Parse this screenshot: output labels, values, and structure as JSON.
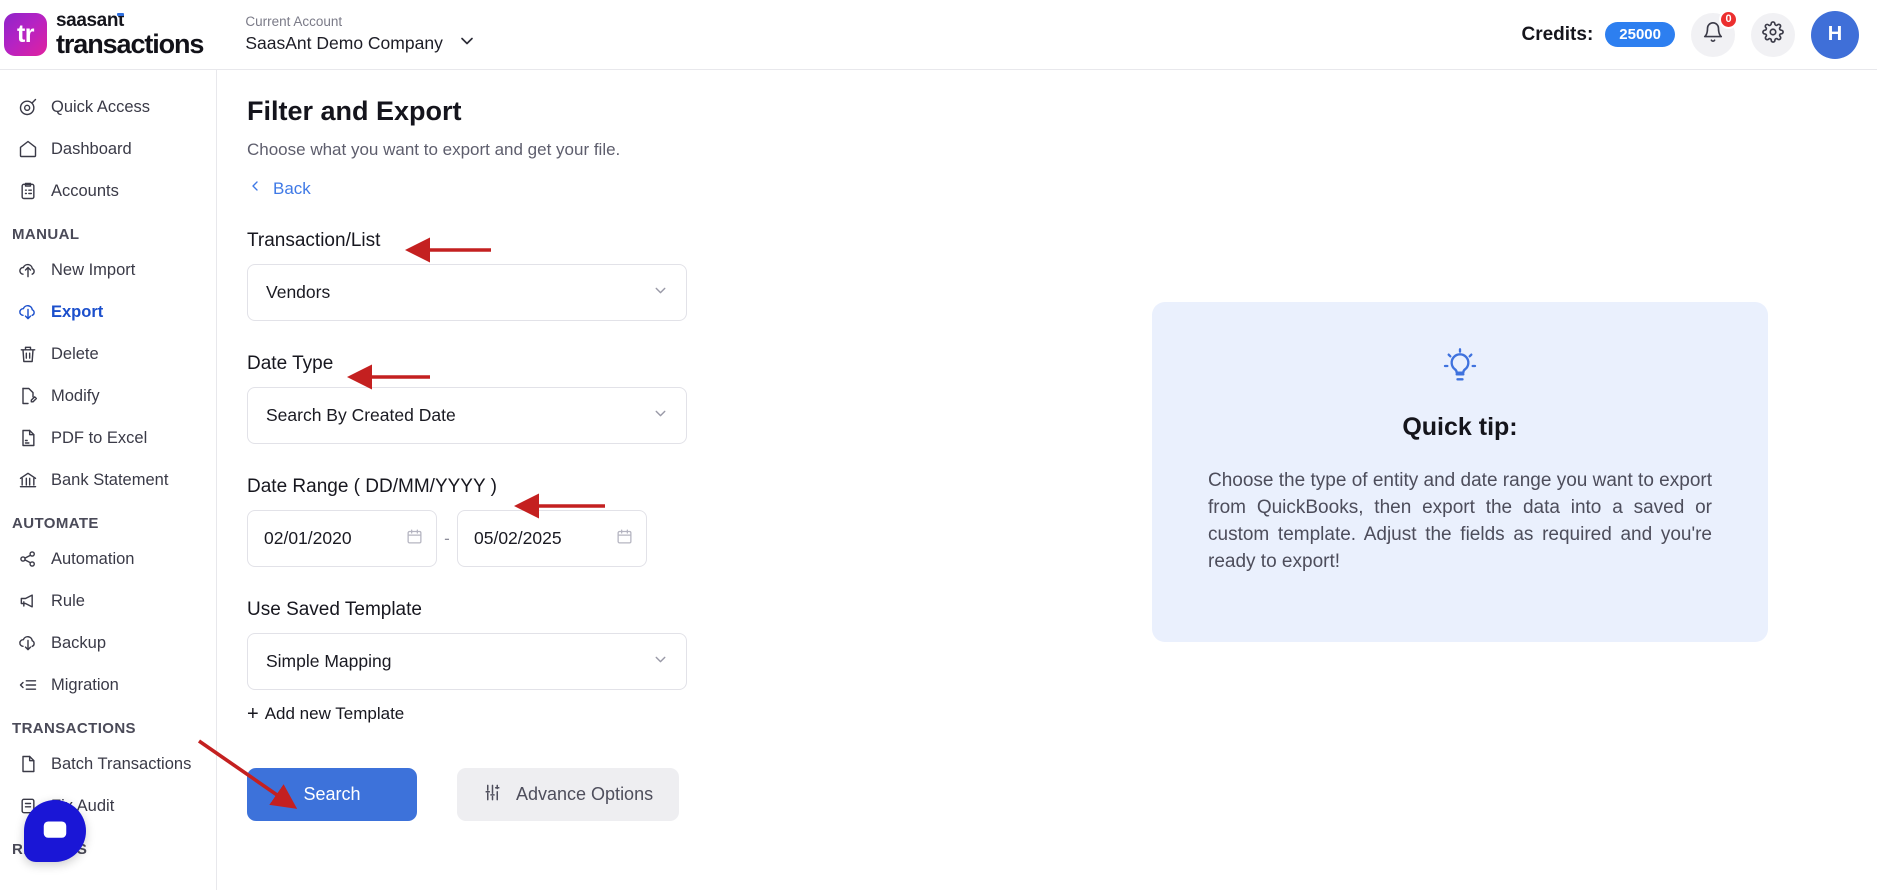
{
  "brand": {
    "logo_mark_text": "tr",
    "name_top": "saasant",
    "name_bottom": "transactions",
    "gradient_from": "#8e24c9",
    "gradient_to": "#e0219f"
  },
  "header": {
    "account_label": "Current Account",
    "account_name": "SaasAnt Demo Company",
    "account_chevron_icon": "chevron-down-icon",
    "credits_label": "Credits:",
    "credits_value": "25000",
    "credits_pill_color": "#2d7ff0",
    "notification_icon": "bell-icon",
    "notification_count": "0",
    "notification_badge_color": "#ec2f2f",
    "settings_icon": "gear-icon",
    "avatar_initial": "H",
    "avatar_color": "#3f6fd8"
  },
  "sidebar": {
    "top_items": [
      {
        "label": "Quick Access",
        "icon": "target-icon",
        "active": false
      },
      {
        "label": "Dashboard",
        "icon": "home-icon",
        "active": false
      },
      {
        "label": "Accounts",
        "icon": "clipboard-icon",
        "active": false
      }
    ],
    "sections": [
      {
        "title": "MANUAL",
        "items": [
          {
            "label": "New Import",
            "icon": "cloud-upload-icon",
            "active": false
          },
          {
            "label": "Export",
            "icon": "cloud-download-icon",
            "active": true
          },
          {
            "label": "Delete",
            "icon": "trash-icon",
            "active": false
          },
          {
            "label": "Modify",
            "icon": "file-edit-icon",
            "active": false
          },
          {
            "label": "PDF to Excel",
            "icon": "pdf-file-icon",
            "active": false
          },
          {
            "label": "Bank Statement",
            "icon": "bank-icon",
            "active": false
          }
        ]
      },
      {
        "title": "AUTOMATE",
        "items": [
          {
            "label": "Automation",
            "icon": "share-nodes-icon",
            "active": false
          },
          {
            "label": "Rule",
            "icon": "megaphone-icon",
            "active": false
          },
          {
            "label": "Backup",
            "icon": "cloud-download-icon",
            "active": false
          },
          {
            "label": "Migration",
            "icon": "list-arrow-icon",
            "active": false
          }
        ]
      },
      {
        "title": "TRANSACTIONS",
        "items": [
          {
            "label": "Batch Transactions",
            "icon": "document-icon",
            "active": false
          },
          {
            "label": "Fix Audit",
            "icon": "document-list-icon",
            "active": false
          }
        ]
      },
      {
        "title": "REPORTS",
        "items": []
      }
    ]
  },
  "main": {
    "title": "Filter and Export",
    "subtitle": "Choose what you want to export and get your file.",
    "back_label": "Back",
    "back_icon": "chevron-left-icon",
    "fields": {
      "transaction_list": {
        "label": "Transaction/List",
        "value": "Vendors",
        "chevron_icon": "chevron-down-icon"
      },
      "date_type": {
        "label": "Date Type",
        "value": "Search By Created Date",
        "chevron_icon": "chevron-down-icon"
      },
      "date_range": {
        "label": "Date Range ( DD/MM/YYYY )",
        "from_value": "02/01/2020",
        "to_value": "05/02/2025",
        "separator": "-",
        "calendar_icon": "calendar-icon"
      },
      "saved_template": {
        "label": "Use Saved Template",
        "value": "Simple Mapping",
        "chevron_icon": "chevron-down-icon"
      }
    },
    "add_template_label": "Add new Template",
    "add_template_icon": "plus-icon",
    "search_button": "Search",
    "search_button_color": "#3d72da",
    "advance_button": "Advance Options",
    "advance_button_icon": "sliders-icon"
  },
  "tip": {
    "icon": "lightbulb-icon",
    "title": "Quick tip:",
    "body": "Choose the type of entity and date range you want to export from QuickBooks, then export the data into a saved or custom template. Adjust the fields as required and you're ready to export!",
    "background": "#eaf0fd"
  },
  "annotations": {
    "color": "#c42020",
    "arrows": [
      "arrow-to-transaction-list-label",
      "arrow-to-date-type-label",
      "arrow-to-date-range-label",
      "arrow-to-search-button"
    ]
  },
  "chat": {
    "icon": "chat-bubble-icon",
    "color": "#1a16d6"
  }
}
